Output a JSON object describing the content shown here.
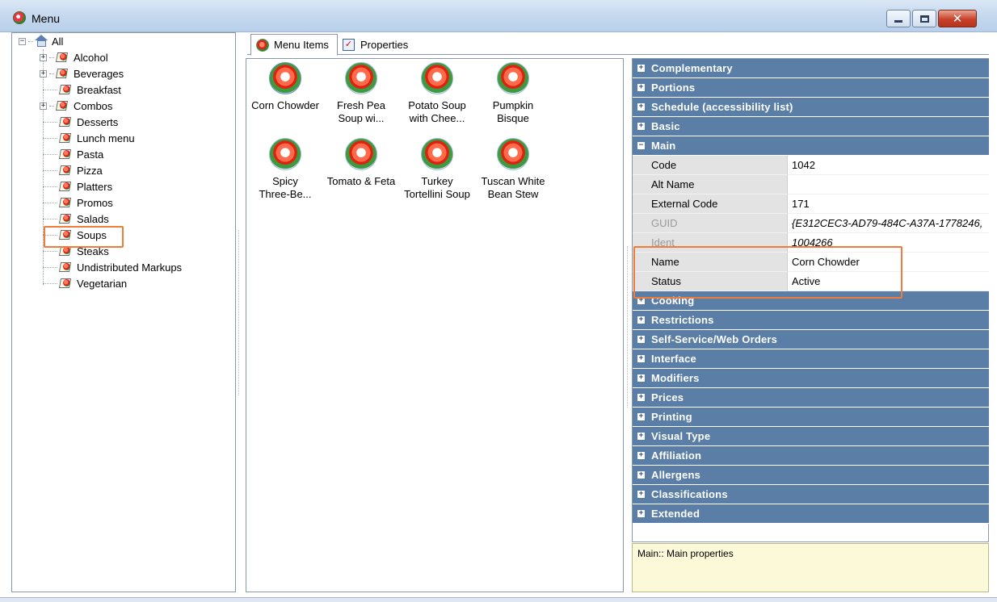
{
  "window": {
    "title": "Menu"
  },
  "tree": {
    "root_label": "All",
    "items": [
      {
        "label": "Alcohol",
        "expandable": true
      },
      {
        "label": "Beverages",
        "expandable": true
      },
      {
        "label": "Breakfast",
        "expandable": false
      },
      {
        "label": "Combos",
        "expandable": true
      },
      {
        "label": "Desserts",
        "expandable": false
      },
      {
        "label": "Lunch menu",
        "expandable": false
      },
      {
        "label": "Pasta",
        "expandable": false
      },
      {
        "label": "Pizza",
        "expandable": false
      },
      {
        "label": "Platters",
        "expandable": false
      },
      {
        "label": "Promos",
        "expandable": false
      },
      {
        "label": "Salads",
        "expandable": false
      },
      {
        "label": "Soups",
        "expandable": false,
        "selected": true
      },
      {
        "label": "Steaks",
        "expandable": false
      },
      {
        "label": "Undistributed Markups",
        "expandable": false
      },
      {
        "label": "Vegetarian",
        "expandable": false
      }
    ]
  },
  "tabs": [
    {
      "label": "Menu Items",
      "active": true
    },
    {
      "label": "Properties",
      "active": false
    }
  ],
  "menu_items": [
    {
      "line1": "Corn Chowder",
      "line2": "",
      "selected": true
    },
    {
      "line1": "Fresh Pea",
      "line2": "Soup wi..."
    },
    {
      "line1": "Potato Soup",
      "line2": "with Chee..."
    },
    {
      "line1": "Pumpkin",
      "line2": "Bisque"
    },
    {
      "line1": "Spicy",
      "line2": "Three-Be..."
    },
    {
      "line1": "Tomato & Feta",
      "line2": ""
    },
    {
      "line1": "Turkey",
      "line2": "Tortellini Soup"
    },
    {
      "line1": "Tuscan White",
      "line2": "Bean Stew"
    }
  ],
  "property_grid": {
    "categories_top": [
      {
        "label": "Complementary",
        "expander": "+"
      },
      {
        "label": "Portions",
        "expander": "+"
      },
      {
        "label": "Schedule (accessibility list)",
        "expander": "+"
      },
      {
        "label": "Basic",
        "expander": "+"
      },
      {
        "label": "Main",
        "expander": "−"
      }
    ],
    "main_props": [
      {
        "name": "Code",
        "value": "1042"
      },
      {
        "name": "Alt Name",
        "value": ""
      },
      {
        "name": "External Code",
        "value": "171"
      },
      {
        "name": "GUID",
        "value": "{E312CEC3-AD79-484C-A37A-1778246,",
        "disabled": true
      },
      {
        "name": "Ident",
        "value": "1004266",
        "disabled": true
      },
      {
        "name": "Name",
        "value": "Corn Chowder"
      },
      {
        "name": "Status",
        "value": "Active"
      }
    ],
    "categories_bottom": [
      {
        "label": "Cooking",
        "expander": "+"
      },
      {
        "label": "Restrictions",
        "expander": "+"
      },
      {
        "label": "Self-Service/Web Orders",
        "expander": "+"
      },
      {
        "label": "Interface",
        "expander": "+"
      },
      {
        "label": "Modifiers",
        "expander": "+"
      },
      {
        "label": "Prices",
        "expander": "+"
      },
      {
        "label": "Printing",
        "expander": "+"
      },
      {
        "label": "Visual Type",
        "expander": "+"
      },
      {
        "label": "Affiliation",
        "expander": "+"
      },
      {
        "label": "Allergens",
        "expander": "+"
      },
      {
        "label": "Classifications",
        "expander": "+"
      },
      {
        "label": "Extended",
        "expander": "+"
      }
    ]
  },
  "description": "Main:: Main properties",
  "colors": {
    "category_header": "#5a7ea6",
    "highlight": "#f07b3a",
    "description_bg": "#fbf9d8"
  }
}
